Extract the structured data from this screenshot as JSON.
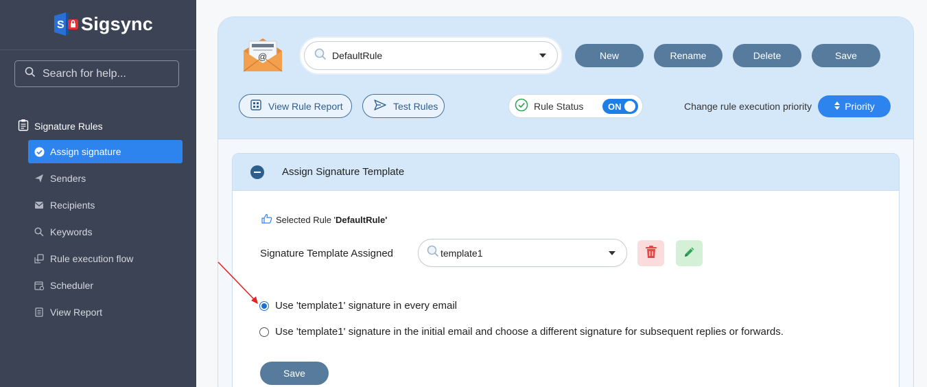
{
  "app": {
    "logo_text": "Sigsync",
    "search_placeholder": "Search for help..."
  },
  "sidebar": {
    "section_label": "Signature Rules",
    "items": [
      {
        "label": "Assign signature",
        "icon": "check-circle-icon",
        "active": true
      },
      {
        "label": "Senders",
        "icon": "send-icon"
      },
      {
        "label": "Recipients",
        "icon": "mail-icon"
      },
      {
        "label": "Keywords",
        "icon": "search-icon"
      },
      {
        "label": "Rule execution flow",
        "icon": "flow-icon"
      },
      {
        "label": "Scheduler",
        "icon": "calendar-icon"
      },
      {
        "label": "View Report",
        "icon": "report-icon"
      }
    ]
  },
  "toolbar": {
    "rule_selected": "DefaultRule",
    "new_label": "New",
    "rename_label": "Rename",
    "delete_label": "Delete",
    "save_label": "Save",
    "view_report_label": "View Rule Report",
    "test_rules_label": "Test Rules",
    "rule_status_label": "Rule Status",
    "rule_status_toggle": "ON",
    "priority_text": "Change rule execution priority",
    "priority_button": "Priority"
  },
  "panel": {
    "title": "Assign Signature Template",
    "selected_rule_prefix": "Selected Rule '",
    "selected_rule_name": "DefaultRule",
    "selected_rule_suffix": "'",
    "signature_label": "Signature Template Assigned",
    "template_value": "template1",
    "radio_options": [
      {
        "label": "Use 'template1' signature in every email",
        "checked": true
      },
      {
        "label": "Use 'template1' signature in the initial email and choose a different signature for subsequent replies or forwards.",
        "checked": false
      }
    ],
    "save_label": "Save"
  },
  "colors": {
    "sidebar_bg": "#3b4354",
    "accent": "#2d84ef",
    "button": "#567b9c",
    "band": "#d5e8f9"
  }
}
